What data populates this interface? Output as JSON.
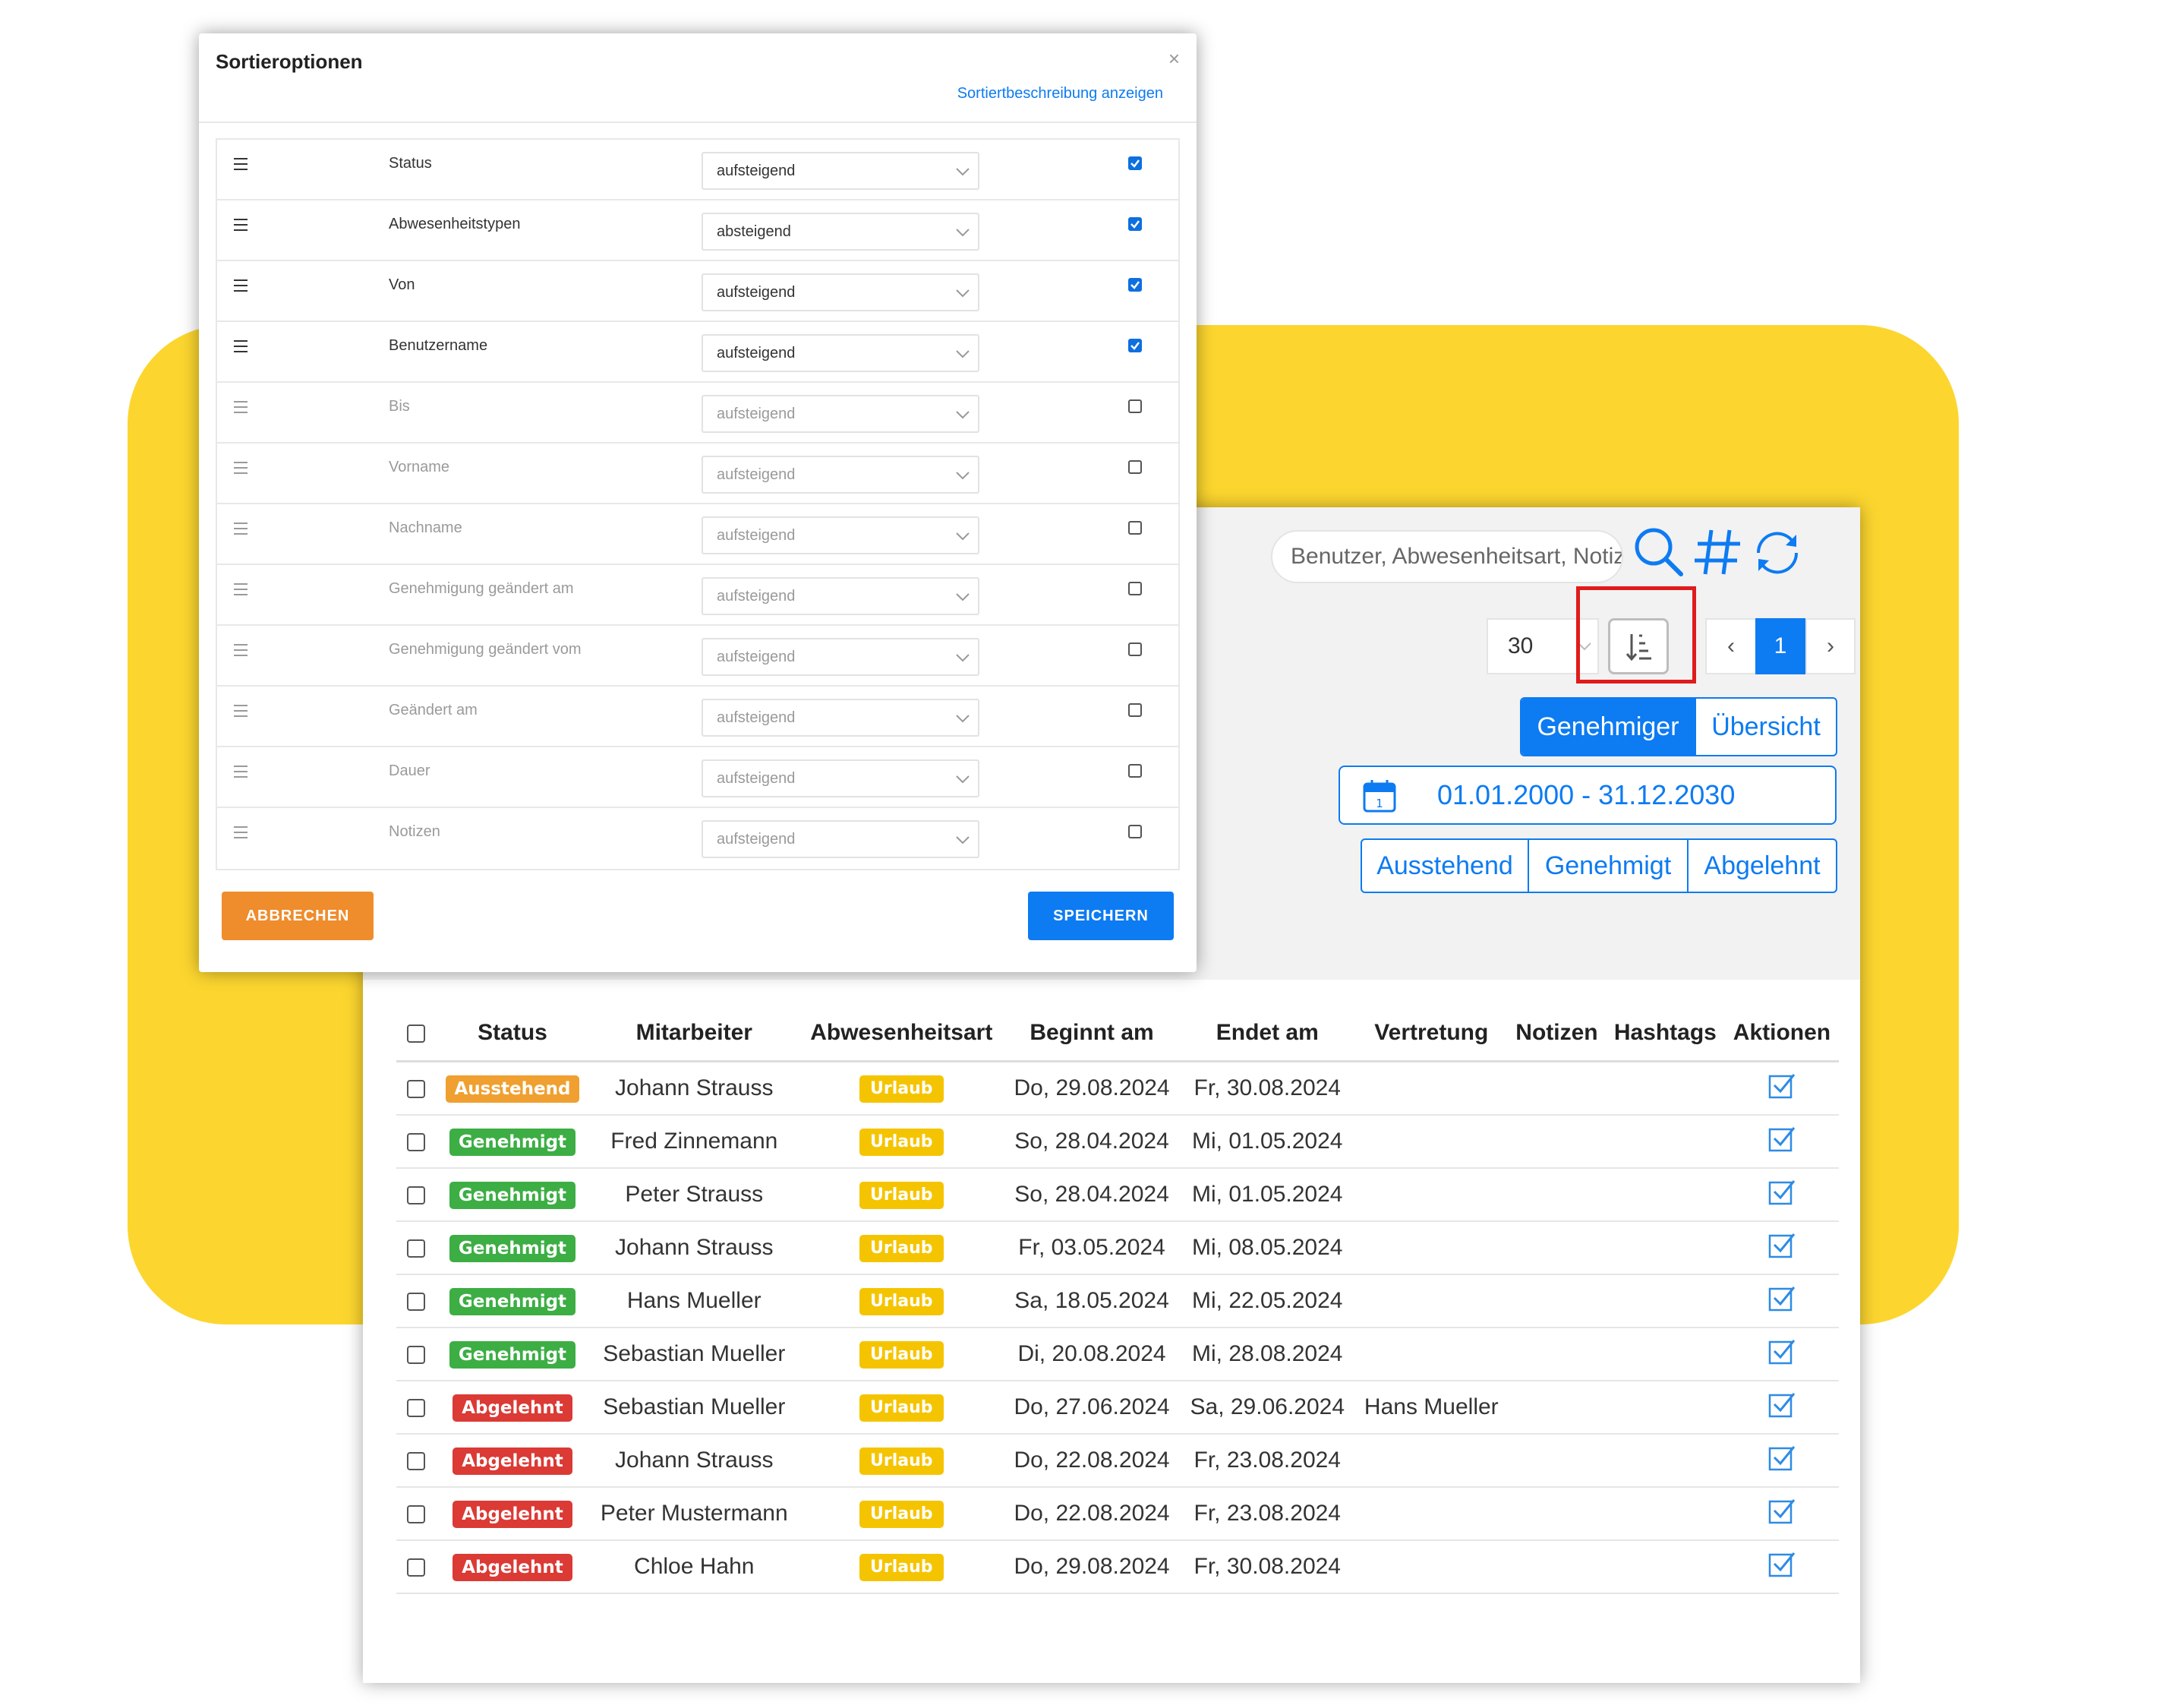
{
  "toolbar": {
    "search_placeholder": "Benutzer, Abwesenheitsart, Notizen",
    "per_page": "30",
    "pager": {
      "prev": "‹",
      "page": "1",
      "next": "›"
    },
    "view_toggle": [
      "Genehmiger",
      "Übersicht"
    ],
    "date_range": "01.01.2000 - 31.12.2030",
    "date_icon_day": "1",
    "status_filters": [
      "Ausstehend",
      "Genehmigt",
      "Abgelehnt"
    ],
    "icons": [
      "search-icon",
      "hashtag-icon",
      "refresh-icon",
      "sort-icon",
      "calendar-icon"
    ]
  },
  "table": {
    "headers": [
      "Status",
      "Mitarbeiter",
      "Abwesenheitsart",
      "Beginnt am",
      "Endet am",
      "Vertretung",
      "Notizen",
      "Hashtags",
      "Aktionen"
    ],
    "rows": [
      {
        "status": "Ausstehend",
        "employee": "Johann Strauss",
        "type": "Urlaub",
        "start": "Do, 29.08.2024",
        "end": "Fr, 30.08.2024",
        "substitute": "",
        "notes": "",
        "hashtags": ""
      },
      {
        "status": "Genehmigt",
        "employee": "Fred Zinnemann",
        "type": "Urlaub",
        "start": "So, 28.04.2024",
        "end": "Mi, 01.05.2024",
        "substitute": "",
        "notes": "",
        "hashtags": ""
      },
      {
        "status": "Genehmigt",
        "employee": "Peter Strauss",
        "type": "Urlaub",
        "start": "So, 28.04.2024",
        "end": "Mi, 01.05.2024",
        "substitute": "",
        "notes": "",
        "hashtags": ""
      },
      {
        "status": "Genehmigt",
        "employee": "Johann Strauss",
        "type": "Urlaub",
        "start": "Fr, 03.05.2024",
        "end": "Mi, 08.05.2024",
        "substitute": "",
        "notes": "",
        "hashtags": ""
      },
      {
        "status": "Genehmigt",
        "employee": "Hans Mueller",
        "type": "Urlaub",
        "start": "Sa, 18.05.2024",
        "end": "Mi, 22.05.2024",
        "substitute": "",
        "notes": "",
        "hashtags": ""
      },
      {
        "status": "Genehmigt",
        "employee": "Sebastian Mueller",
        "type": "Urlaub",
        "start": "Di, 20.08.2024",
        "end": "Mi, 28.08.2024",
        "substitute": "",
        "notes": "",
        "hashtags": ""
      },
      {
        "status": "Abgelehnt",
        "employee": "Sebastian Mueller",
        "type": "Urlaub",
        "start": "Do, 27.06.2024",
        "end": "Sa, 29.06.2024",
        "substitute": "Hans Mueller",
        "notes": "",
        "hashtags": ""
      },
      {
        "status": "Abgelehnt",
        "employee": "Johann Strauss",
        "type": "Urlaub",
        "start": "Do, 22.08.2024",
        "end": "Fr, 23.08.2024",
        "substitute": "",
        "notes": "",
        "hashtags": ""
      },
      {
        "status": "Abgelehnt",
        "employee": "Peter Mustermann",
        "type": "Urlaub",
        "start": "Do, 22.08.2024",
        "end": "Fr, 23.08.2024",
        "substitute": "",
        "notes": "",
        "hashtags": ""
      },
      {
        "status": "Abgelehnt",
        "employee": "Chloe Hahn",
        "type": "Urlaub",
        "start": "Do, 29.08.2024",
        "end": "Fr, 30.08.2024",
        "substitute": "",
        "notes": "",
        "hashtags": ""
      }
    ]
  },
  "status_colors": {
    "Ausstehend": "#f0a030",
    "Genehmigt": "#3cae44",
    "Abgelehnt": "#db3a35"
  },
  "modal": {
    "title": "Sortieroptionen",
    "close": "×",
    "description_link": "Sortiertbeschreibung anzeigen",
    "rows": [
      {
        "label": "Status",
        "order": "aufsteigend",
        "checked": true
      },
      {
        "label": "Abwesenheitstypen",
        "order": "absteigend",
        "checked": true
      },
      {
        "label": "Von",
        "order": "aufsteigend",
        "checked": true
      },
      {
        "label": "Benutzername",
        "order": "aufsteigend",
        "checked": true
      },
      {
        "label": "Bis",
        "order": "aufsteigend",
        "checked": false
      },
      {
        "label": "Vorname",
        "order": "aufsteigend",
        "checked": false
      },
      {
        "label": "Nachname",
        "order": "aufsteigend",
        "checked": false
      },
      {
        "label": "Genehmigung geändert am",
        "order": "aufsteigend",
        "checked": false
      },
      {
        "label": "Genehmigung geändert vom",
        "order": "aufsteigend",
        "checked": false
      },
      {
        "label": "Geändert am",
        "order": "aufsteigend",
        "checked": false
      },
      {
        "label": "Dauer",
        "order": "aufsteigend",
        "checked": false
      },
      {
        "label": "Notizen",
        "order": "aufsteigend",
        "checked": false
      }
    ],
    "cancel_label": "ABBRECHEN",
    "save_label": "SPEICHERN"
  }
}
